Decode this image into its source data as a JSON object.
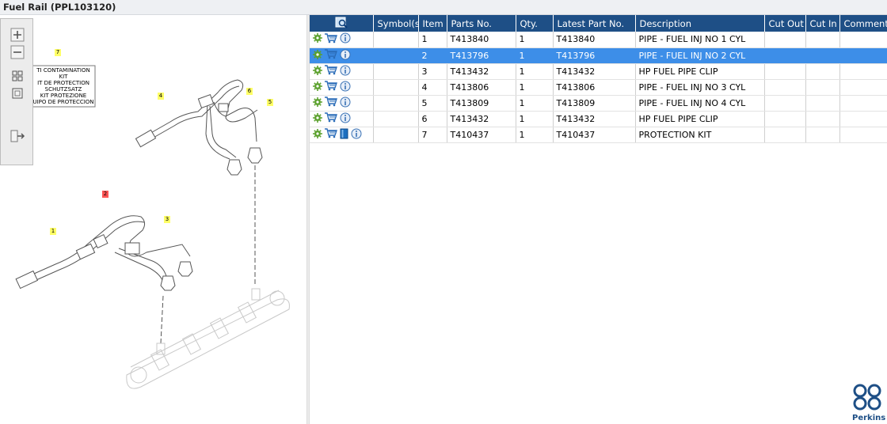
{
  "window": {
    "title": "Fuel Rail (PPL103120)"
  },
  "toolbar": {
    "icons": [
      "zoom-in-icon",
      "zoom-out-icon",
      "fit-window-icon",
      "actual-size-icon",
      "show-list-icon"
    ]
  },
  "drawing": {
    "callout_box": {
      "lines": [
        "TI CONTAMINATION KIT",
        "IT DE PROTECTION",
        "SCHUTZSATZ",
        "KIT PROTEZIONE",
        "UIPO DE PROTECCION"
      ]
    },
    "callouts": [
      {
        "label": "7",
        "color": "#ffff66"
      },
      {
        "label": "4",
        "color": "#ffff66"
      },
      {
        "label": "6",
        "color": "#ffff66"
      },
      {
        "label": "5",
        "color": "#ffff66"
      },
      {
        "label": "2",
        "color": "#ff5555"
      },
      {
        "label": "3",
        "color": "#ffff66"
      },
      {
        "label": "1",
        "color": "#ffff66"
      }
    ]
  },
  "grid": {
    "columns": [
      "",
      "Symbol(s)",
      "Item",
      "Parts No.",
      "Qty.",
      "Latest Part No.",
      "Description",
      "Cut Out",
      "Cut In",
      "Comment"
    ],
    "selected_index": 1,
    "rows": [
      {
        "item": "1",
        "part_no": "T413840",
        "qty": "1",
        "latest": "T413840",
        "desc": "PIPE - FUEL INJ NO 1 CYL",
        "book": false
      },
      {
        "item": "2",
        "part_no": "T413796",
        "qty": "1",
        "latest": "T413796",
        "desc": "PIPE - FUEL INJ NO 2 CYL",
        "book": false
      },
      {
        "item": "3",
        "part_no": "T413432",
        "qty": "1",
        "latest": "T413432",
        "desc": "HP FUEL PIPE CLIP",
        "book": false
      },
      {
        "item": "4",
        "part_no": "T413806",
        "qty": "1",
        "latest": "T413806",
        "desc": "PIPE - FUEL INJ NO 3 CYL",
        "book": false
      },
      {
        "item": "5",
        "part_no": "T413809",
        "qty": "1",
        "latest": "T413809",
        "desc": "PIPE - FUEL INJ NO 4 CYL",
        "book": false
      },
      {
        "item": "6",
        "part_no": "T413432",
        "qty": "1",
        "latest": "T413432",
        "desc": "HP FUEL PIPE CLIP",
        "book": false
      },
      {
        "item": "7",
        "part_no": "T410437",
        "qty": "1",
        "latest": "T410437",
        "desc": "PROTECTION KIT",
        "book": true
      }
    ]
  },
  "brand": {
    "name": "Perkins",
    "color": "#1e4f86"
  },
  "colors": {
    "header": "#1e4f86",
    "selection": "#3d8ee8",
    "gear": "#5aa02c"
  }
}
